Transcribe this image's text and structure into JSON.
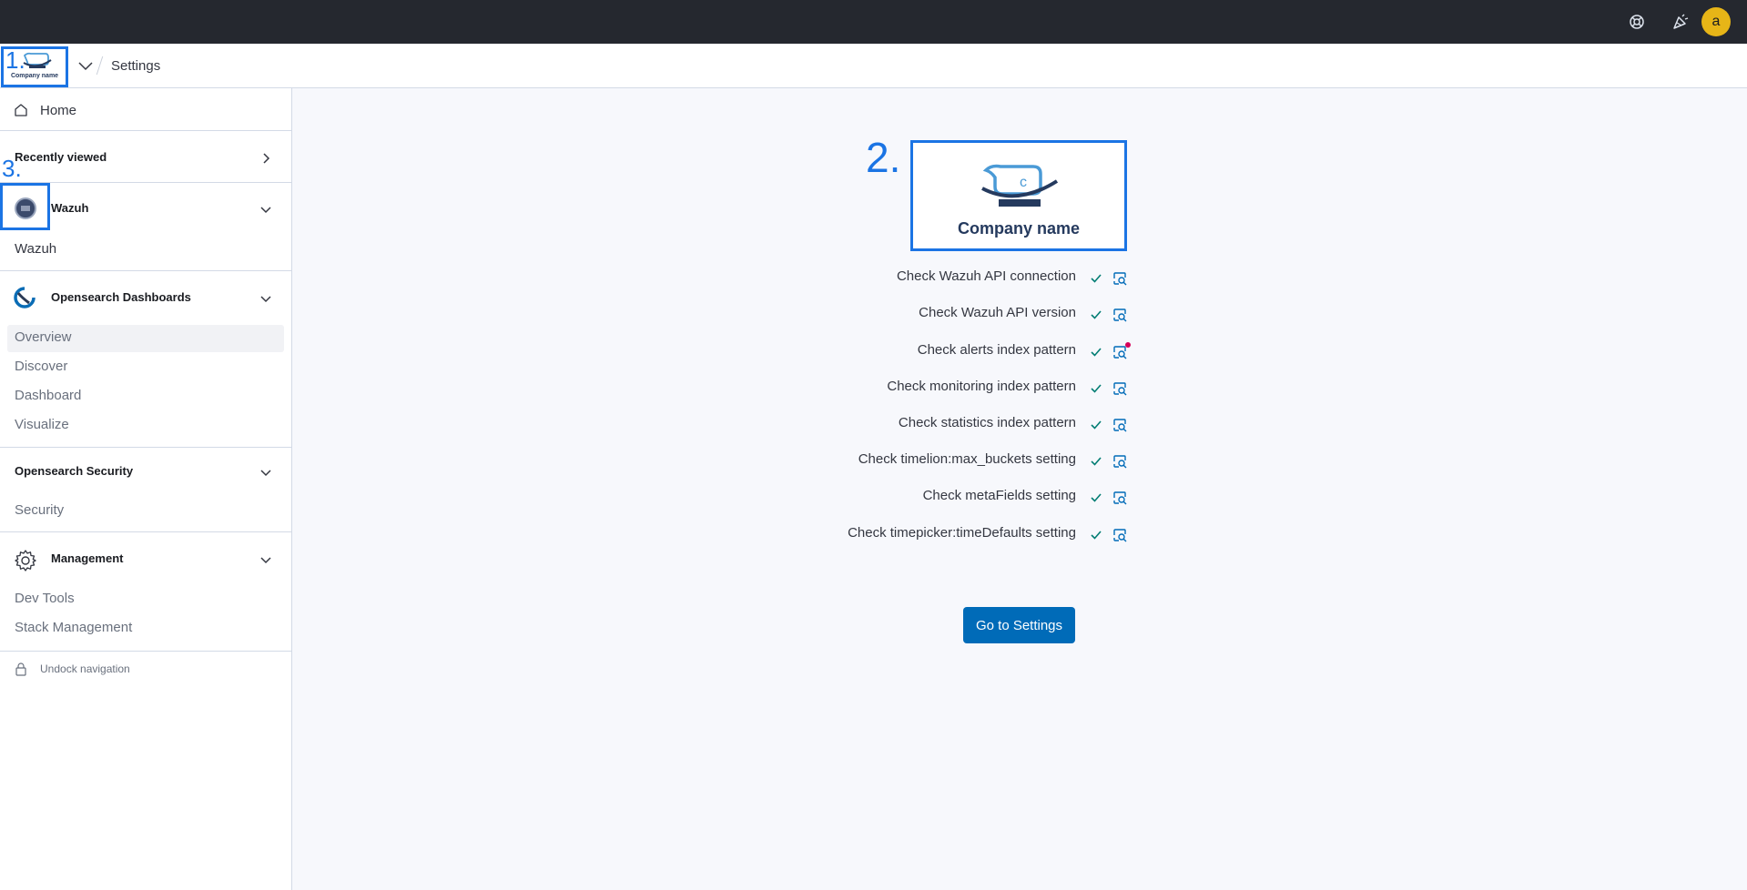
{
  "header": {
    "breadcrumb": "Settings",
    "logo_company": "Company name",
    "markers": {
      "logo": "1.",
      "brand": "2.",
      "app": "3."
    }
  },
  "topbar": {
    "icons": [
      "help-icon",
      "newsfeed-icon"
    ],
    "avatar_initial": "a",
    "accent_color": "#25282f"
  },
  "sidebar": {
    "home": "Home",
    "recently_viewed": "Recently viewed",
    "wazuh": {
      "title": "Wazuh",
      "items": [
        "Wazuh"
      ]
    },
    "opensearch_dashboards": {
      "title": "Opensearch Dashboards",
      "items": [
        "Overview",
        "Discover",
        "Dashboard",
        "Visualize"
      ]
    },
    "opensearch_security": {
      "title": "Opensearch Security",
      "items": [
        "Security"
      ]
    },
    "management": {
      "title": "Management",
      "items": [
        "Dev Tools",
        "Stack Management"
      ]
    },
    "undock": "Undock navigation"
  },
  "main": {
    "brand_name": "Company name",
    "checks": [
      "Check Wazuh API connection",
      "Check Wazuh API version",
      "Check alerts index pattern",
      "Check monitoring index pattern",
      "Check statistics index pattern",
      "Check timelion:max_buckets setting",
      "Check metaFields setting",
      "Check timepicker:timeDefaults setting"
    ],
    "go_button": "Go to Settings",
    "colors": {
      "primary": "#006bb8",
      "success": "#017d73",
      "highlight": "#1b74e4"
    }
  }
}
